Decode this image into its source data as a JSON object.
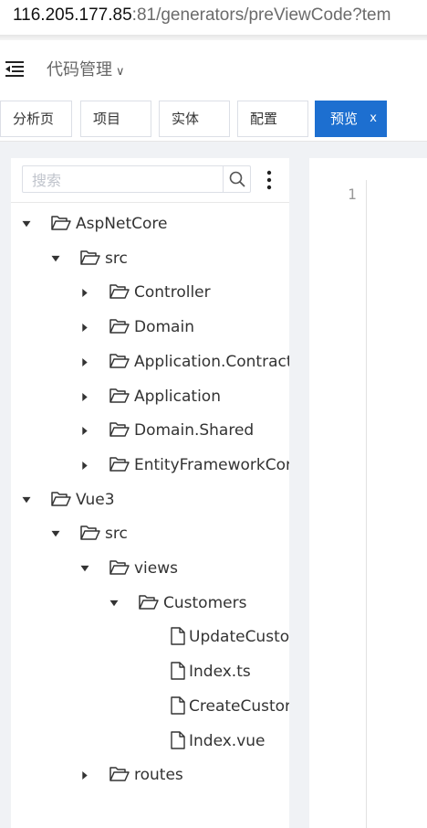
{
  "address_bar": {
    "host": "116.205.177.85",
    "rest": ":81/generators/preViewCode?tem"
  },
  "header": {
    "title": "代码管理"
  },
  "tabs": [
    {
      "label": "分析页",
      "active": false
    },
    {
      "label": "项目",
      "active": false
    },
    {
      "label": "实体",
      "active": false
    },
    {
      "label": "配置",
      "active": false
    },
    {
      "label": "预览",
      "active": true,
      "close": "x"
    }
  ],
  "search": {
    "placeholder": "搜索"
  },
  "tree": [
    {
      "label": "AspNetCore",
      "type": "folder",
      "expanded": true,
      "depth": 0
    },
    {
      "label": "src",
      "type": "folder",
      "expanded": true,
      "depth": 1
    },
    {
      "label": "Controller",
      "type": "folder",
      "expanded": false,
      "depth": 2
    },
    {
      "label": "Domain",
      "type": "folder",
      "expanded": false,
      "depth": 2
    },
    {
      "label": "Application.Contract",
      "type": "folder",
      "expanded": false,
      "depth": 2
    },
    {
      "label": "Application",
      "type": "folder",
      "expanded": false,
      "depth": 2
    },
    {
      "label": "Domain.Shared",
      "type": "folder",
      "expanded": false,
      "depth": 2
    },
    {
      "label": "EntityFrameworkCor",
      "type": "folder",
      "expanded": false,
      "depth": 2
    },
    {
      "label": "Vue3",
      "type": "folder",
      "expanded": true,
      "depth": 0
    },
    {
      "label": "src",
      "type": "folder",
      "expanded": true,
      "depth": 1
    },
    {
      "label": "views",
      "type": "folder",
      "expanded": true,
      "depth": 2
    },
    {
      "label": "Customers",
      "type": "folder",
      "expanded": true,
      "depth": 3
    },
    {
      "label": "UpdateCusto",
      "type": "file",
      "depth": 4
    },
    {
      "label": "Index.ts",
      "type": "file",
      "depth": 4
    },
    {
      "label": "CreateCustor",
      "type": "file",
      "depth": 4
    },
    {
      "label": "Index.vue",
      "type": "file",
      "depth": 4
    },
    {
      "label": "routes",
      "type": "folder",
      "expanded": false,
      "depth": 2
    }
  ],
  "editor": {
    "line_number": "1"
  }
}
